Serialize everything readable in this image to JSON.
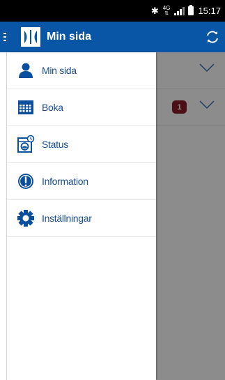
{
  "status_bar": {
    "network_label": "4G",
    "time": "15:17",
    "icons": [
      "bluetooth-icon",
      "signal-icon",
      "battery-icon"
    ]
  },
  "app_bar": {
    "title": "Min sida",
    "icons": [
      "menu-icon",
      "electrolux-logo-icon",
      "refresh-icon"
    ],
    "color": "#0a56a6"
  },
  "drawer": {
    "items": [
      {
        "label": "Min sida",
        "icon": "person-icon"
      },
      {
        "label": "Boka",
        "icon": "calendar-icon"
      },
      {
        "label": "Status",
        "icon": "washing-machine-icon"
      },
      {
        "label": "Information",
        "icon": "info-icon"
      },
      {
        "label": "Inställningar",
        "icon": "gear-icon"
      }
    ]
  },
  "background_list": {
    "badge_count": "1",
    "badge_color": "#8b1a2a"
  }
}
